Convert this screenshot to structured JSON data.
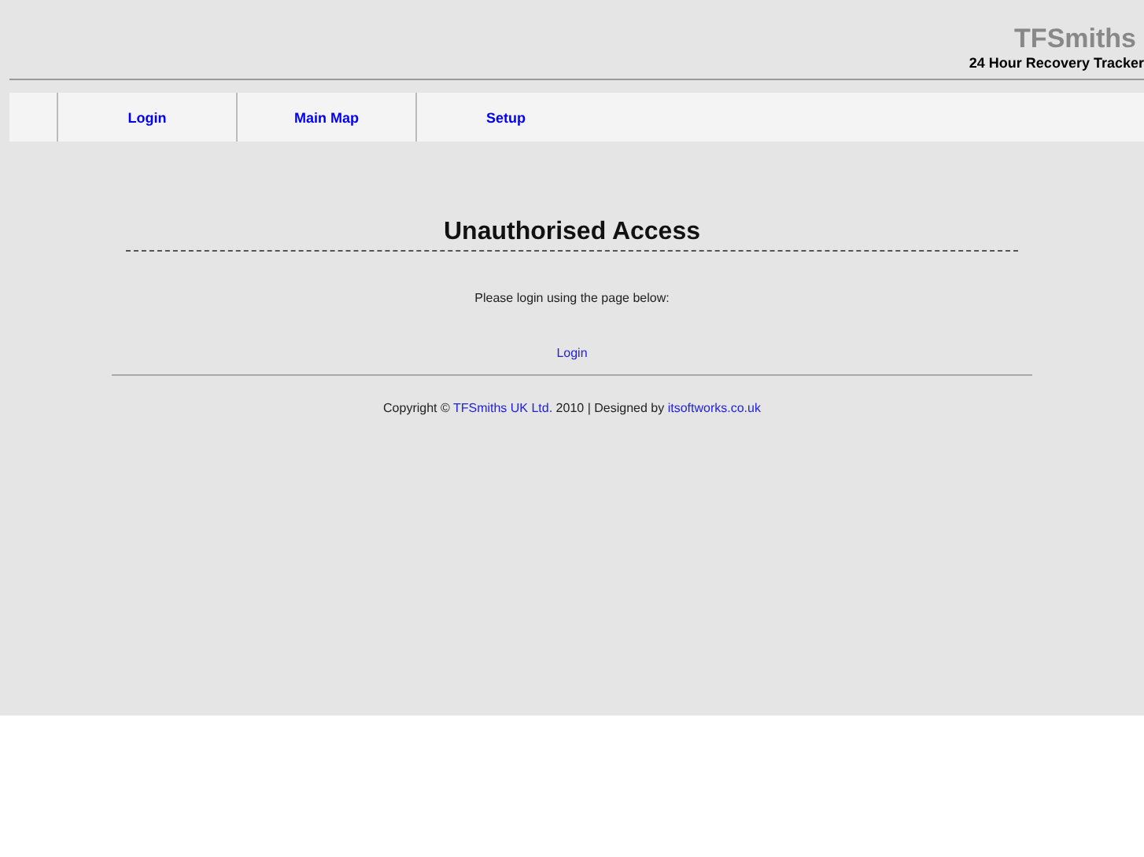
{
  "header": {
    "logo": "TFSmiths",
    "tagline": "24 Hour Recovery Tracker"
  },
  "nav": [
    {
      "label": "Login"
    },
    {
      "label": "Main Map"
    },
    {
      "label": "Setup"
    }
  ],
  "content": {
    "title": "Unauthorised Access",
    "message": "Please login using the page below:",
    "link": "Login"
  },
  "footer": {
    "parts": [
      {
        "kind": "text",
        "text": "Copyright © "
      },
      {
        "kind": "link",
        "text": "TFSmiths UK Ltd."
      },
      {
        "kind": "text",
        "text": " 2010 | Designed by "
      },
      {
        "kind": "link",
        "text": "itsoftworks.co.uk"
      }
    ]
  }
}
